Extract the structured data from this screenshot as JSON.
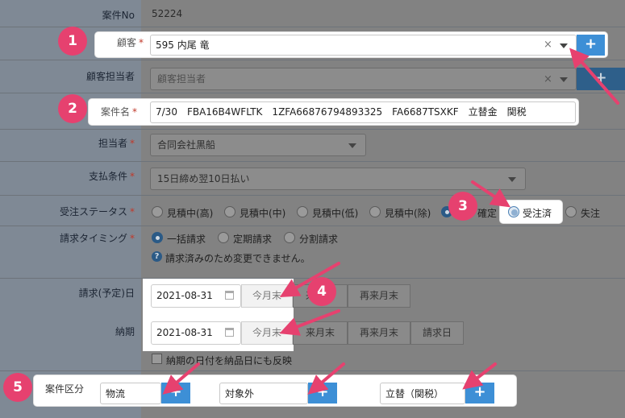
{
  "form": {
    "case_no": {
      "label": "案件No",
      "value": "52224"
    },
    "customer": {
      "label": "顧客",
      "value": "595 内尾 竜",
      "clear": "×"
    },
    "customer_contact": {
      "label": "顧客担当者",
      "placeholder": "顧客担当者",
      "clear": "×"
    },
    "case_name": {
      "label": "案件名",
      "value": "7/30　FBA16B4WFLTK　1ZFA66876794893325　FA6687TSXKF　立替金　関税"
    },
    "assignee": {
      "label": "担当者",
      "value": "合同会社黒船"
    },
    "payment_terms": {
      "label": "支払条件",
      "value": "15日締め翌10日払い"
    },
    "order_status": {
      "label": "受注ステータス",
      "options": [
        "見積中(高)",
        "見積中(中)",
        "見積中(低)",
        "見積中(除)",
        "確定",
        "受注済",
        "失注"
      ],
      "selected": "受注済"
    },
    "billing_timing": {
      "label": "請求タイミング",
      "options": [
        "一括請求",
        "定期請求",
        "分割請求"
      ],
      "selected": "一括請求",
      "notice": "請求済みのため変更できません。"
    },
    "billing_date": {
      "label": "請求(予定)日",
      "value": "2021-08-31",
      "buttons": [
        "今月末",
        "来月末",
        "再来月末"
      ]
    },
    "delivery_date": {
      "label": "納期",
      "value": "2021-08-31",
      "buttons": [
        "今月末",
        "来月末",
        "再来月末",
        "請求日"
      ],
      "reflect_label": "納期の日付を納品日にも反映"
    },
    "case_category": {
      "label": "案件区分",
      "fields": [
        "物流",
        "対象外",
        "立替（関税）"
      ]
    }
  },
  "annotations": [
    "1",
    "2",
    "3",
    "4",
    "5"
  ],
  "plus": "+",
  "required_mark": "*",
  "colors": {
    "annotation": "#e6416f",
    "accent": "#3d8fd6"
  }
}
